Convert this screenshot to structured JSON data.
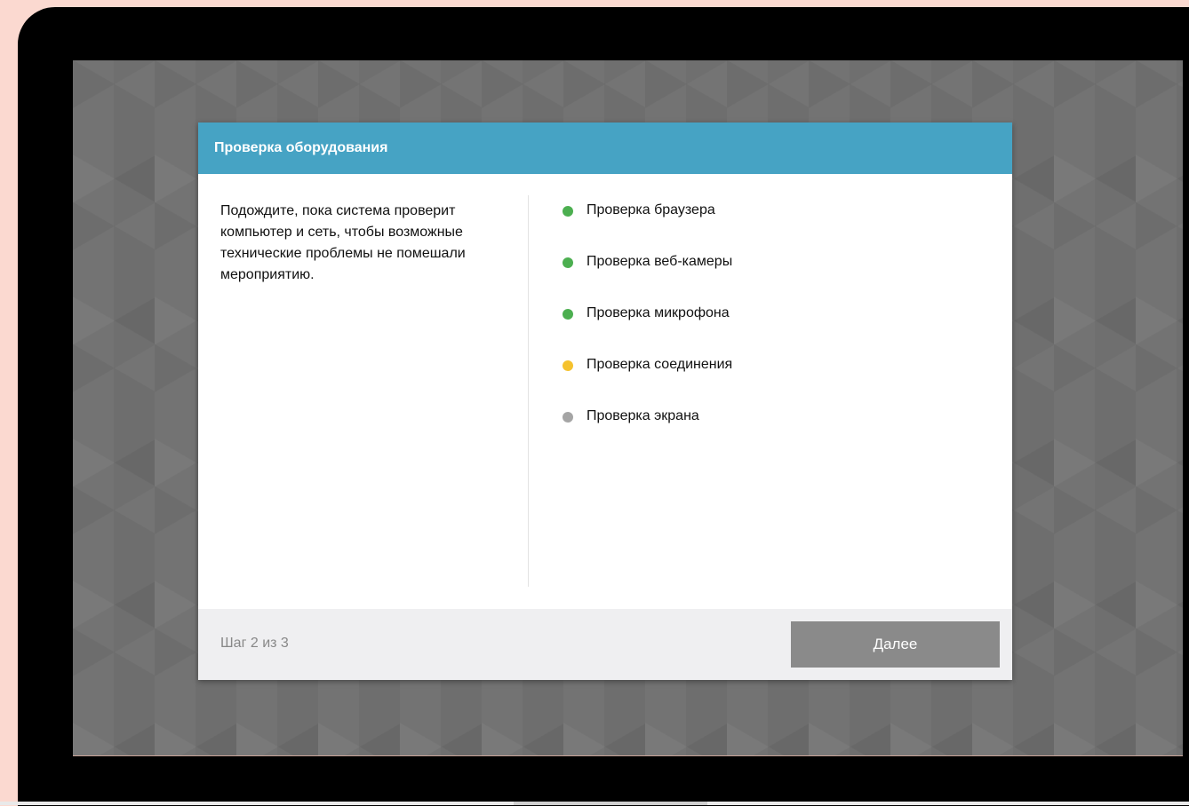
{
  "dialog": {
    "title": "Проверка оборудования",
    "description": "Подождите, пока система проверит компьютер и сеть, чтобы возможные технические проблемы не помешали мероприятию.",
    "checks": [
      {
        "label": "Проверка браузера",
        "status": "done",
        "color": "#4caf50"
      },
      {
        "label": "Проверка веб-камеры",
        "status": "done",
        "color": "#4caf50"
      },
      {
        "label": "Проверка микрофона",
        "status": "done",
        "color": "#4caf50"
      },
      {
        "label": "Проверка соединения",
        "status": "in-progress",
        "color": "#f5c22e"
      },
      {
        "label": "Проверка экрана",
        "status": "pending",
        "color": "#a5a5a5"
      }
    ],
    "footer": {
      "step_text": "Шаг 2 из 3",
      "next_label": "Далее"
    }
  },
  "colors": {
    "header": "#46a3c4",
    "button_disabled": "#8a8a8a"
  }
}
